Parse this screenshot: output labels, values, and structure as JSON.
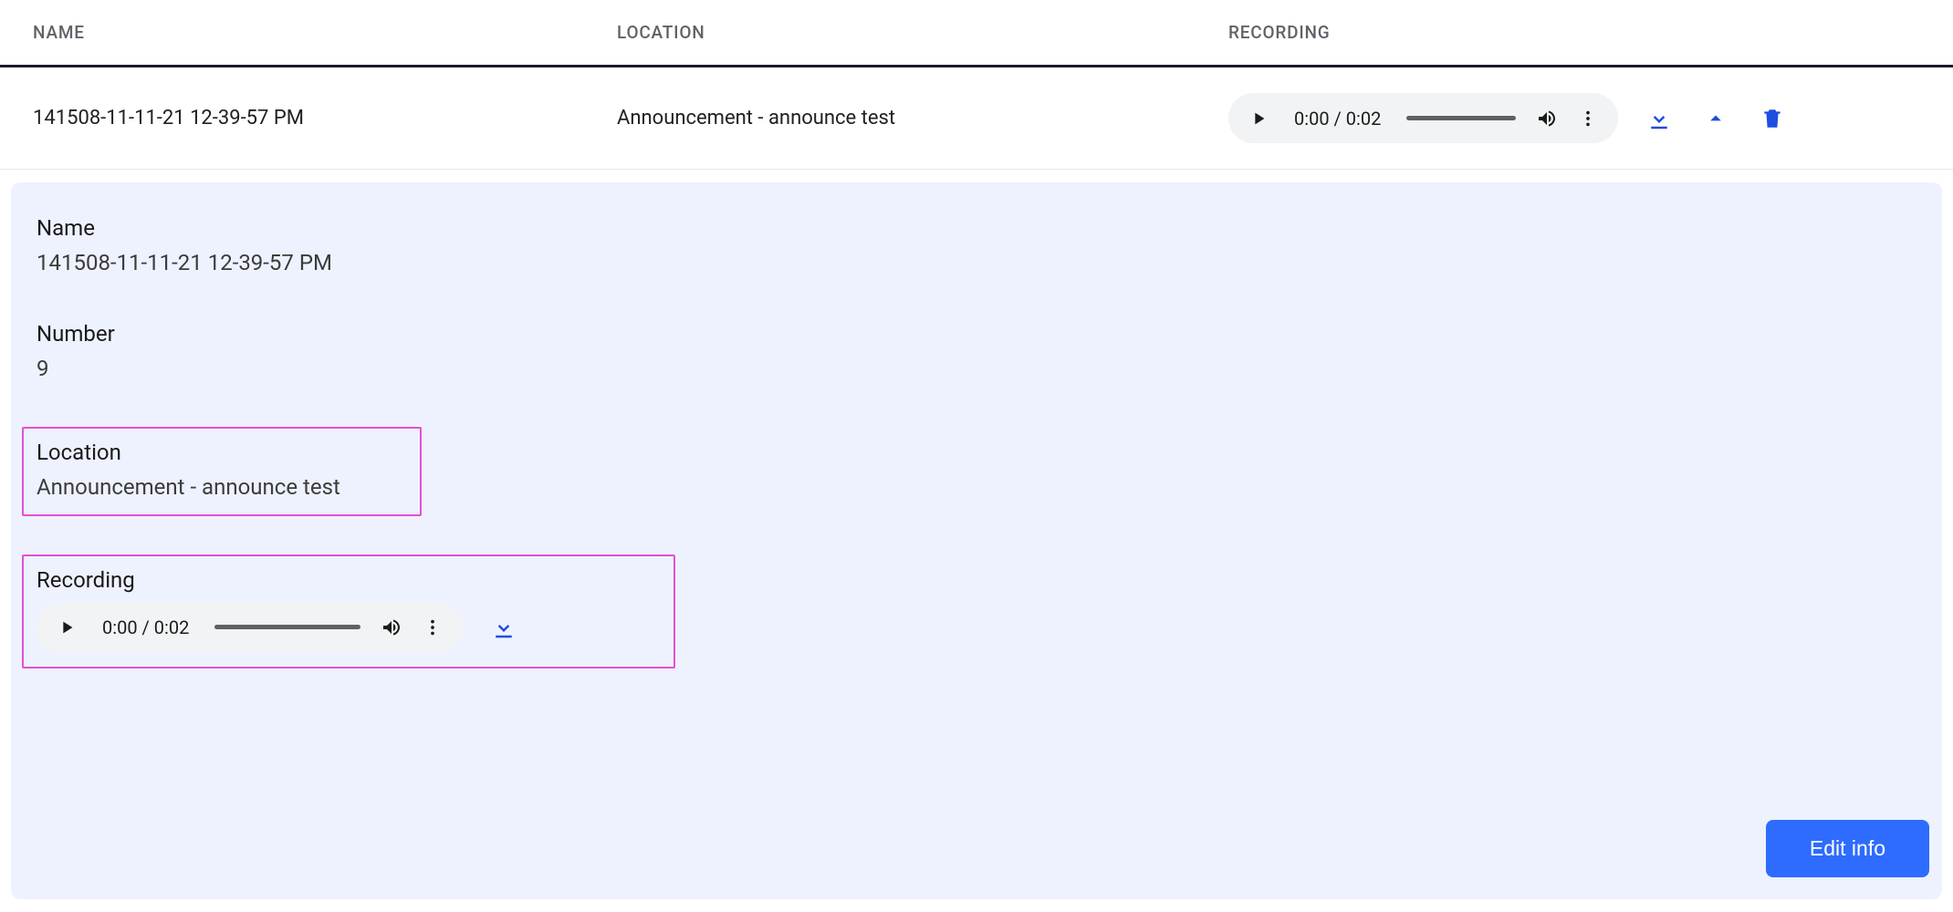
{
  "columns": {
    "name": "NAME",
    "location": "LOCATION",
    "recording": "RECORDING"
  },
  "row": {
    "name": "141508-11-11-21 12-39-57 PM",
    "location": "Announcement - announce test",
    "audio": {
      "current": "0:00",
      "duration": "0:02"
    }
  },
  "detail": {
    "name_label": "Name",
    "name_value": "141508-11-11-21 12-39-57 PM",
    "number_label": "Number",
    "number_value": "9",
    "location_label": "Location",
    "location_value": "Announcement - announce test",
    "recording_label": "Recording",
    "audio": {
      "current": "0:00",
      "duration": "0:02"
    },
    "edit_label": "Edit info"
  },
  "colors": {
    "accent": "#2e6cff",
    "highlight_border": "#e64fd1",
    "panel_bg": "#eef2ff"
  }
}
